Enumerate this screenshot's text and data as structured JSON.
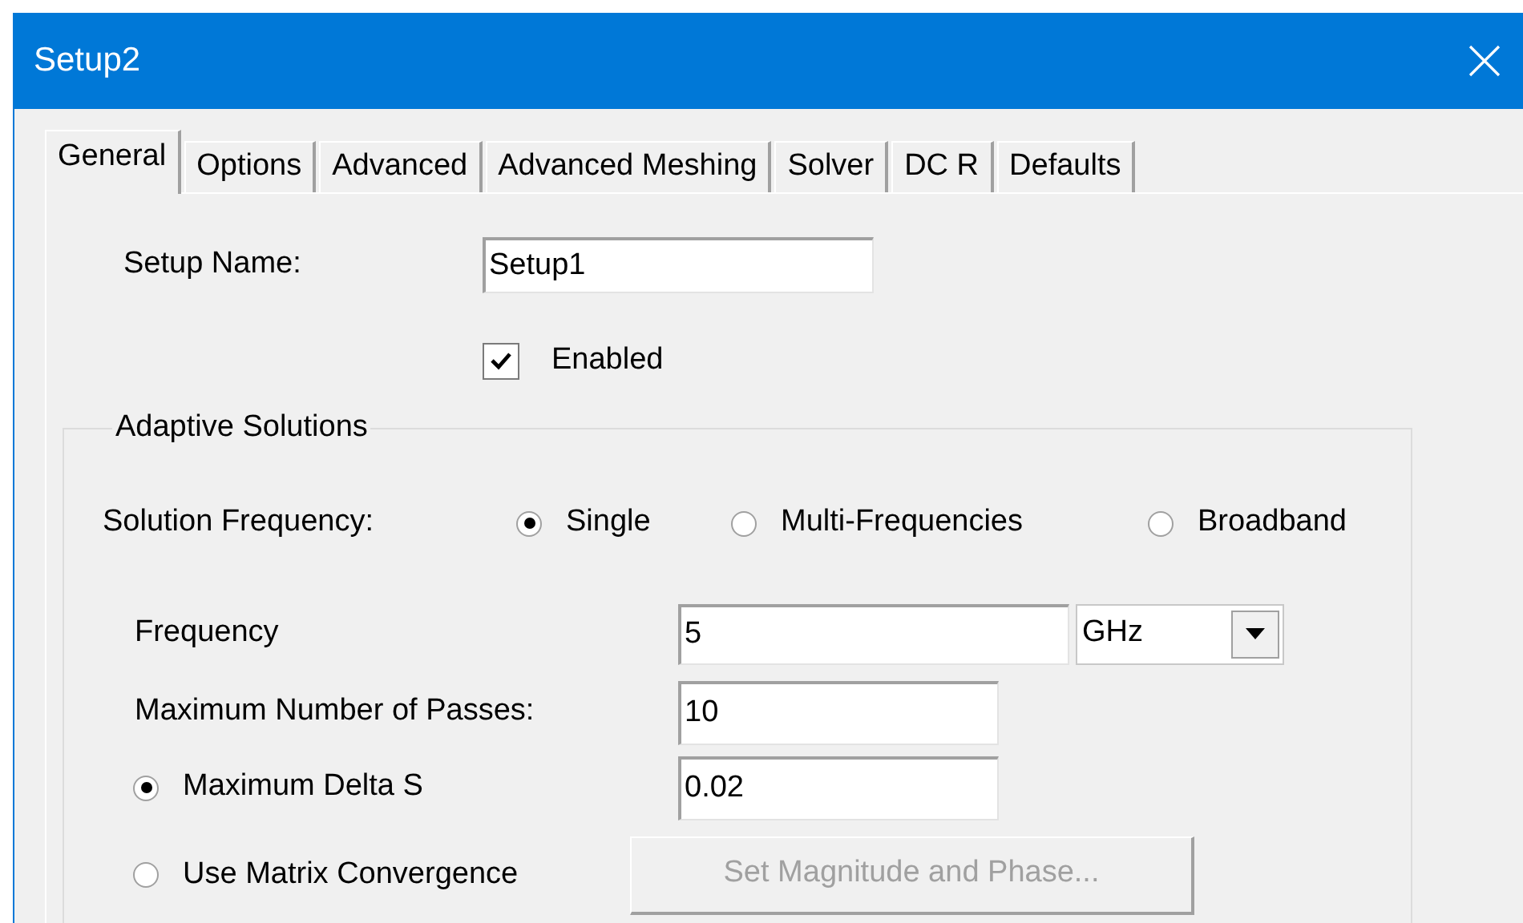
{
  "window": {
    "title": "Setup2"
  },
  "tabs": [
    {
      "label": "General",
      "selected": true
    },
    {
      "label": "Options",
      "selected": false
    },
    {
      "label": "Advanced",
      "selected": false
    },
    {
      "label": "Advanced Meshing",
      "selected": false
    },
    {
      "label": "Solver",
      "selected": false
    },
    {
      "label": "DC R",
      "selected": false
    },
    {
      "label": "Defaults",
      "selected": false
    }
  ],
  "setup_name": {
    "label": "Setup Name:",
    "value": "Setup1"
  },
  "enabled": {
    "label": "Enabled",
    "checked": true
  },
  "adaptive_solutions": {
    "title": "Adaptive Solutions",
    "solution_frequency": {
      "label": "Solution Frequency:",
      "options": [
        {
          "label": "Single",
          "selected": true
        },
        {
          "label": "Multi-Frequencies",
          "selected": false
        },
        {
          "label": "Broadband",
          "selected": false
        }
      ]
    },
    "frequency": {
      "label": "Frequency",
      "value": "5",
      "unit": "GHz"
    },
    "max_passes": {
      "label": "Maximum Number of Passes:",
      "value": "10"
    },
    "convergence": [
      {
        "kind": "field",
        "label": "Maximum Delta S",
        "selected": true,
        "value": "0.02"
      },
      {
        "kind": "button",
        "label": "Use Matrix Convergence",
        "selected": false,
        "button": {
          "label": "Set Magnitude and Phase...",
          "disabled": true
        }
      }
    ]
  }
}
